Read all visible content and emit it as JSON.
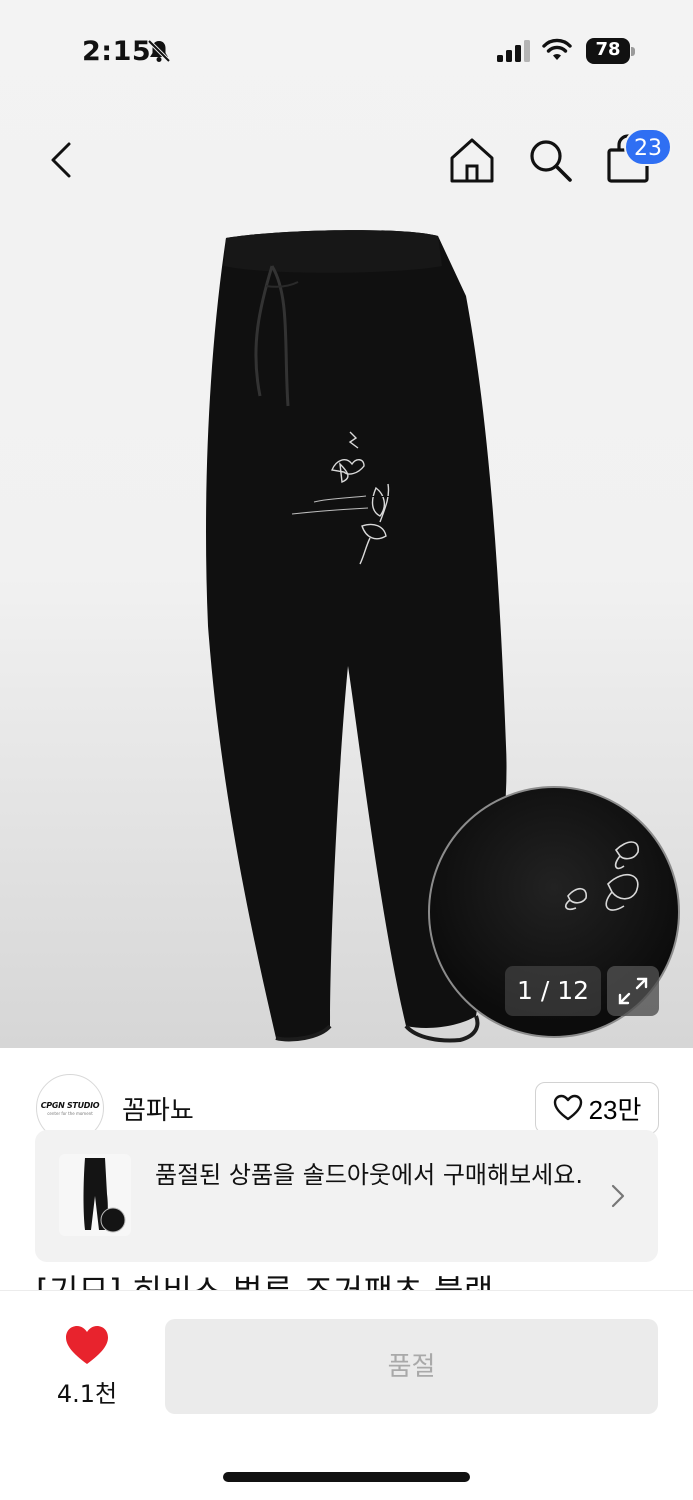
{
  "status_bar": {
    "time": "2:15",
    "battery_level": "78",
    "icons": [
      "bell-slash-icon",
      "cellular-signal-icon",
      "wifi-icon",
      "battery-icon"
    ]
  },
  "nav": {
    "icons": [
      "back-chevron-icon",
      "home-icon",
      "search-icon",
      "shopping-bag-icon"
    ],
    "cart_count": "23"
  },
  "gallery": {
    "counter": "1 / 12",
    "current_index": 1,
    "total": 12
  },
  "brand": {
    "logo_text": "CPGN STUDIO",
    "logo_subtext": "center for the moment",
    "name": "꼼파뇨",
    "like_count": "23만"
  },
  "soldout_banner": {
    "text": "품절된 상품을 솔드아웃에서 구매해보세요."
  },
  "product": {
    "title": "[기모] 히비스 벌룬 조거팬츠 블랙"
  },
  "bottom_bar": {
    "favorite_count": "4.1천",
    "purchase_button_label": "품절"
  },
  "colors": {
    "accent_badge": "#2f6ff3",
    "heart_red": "#e8232d",
    "disabled_button_bg": "#ebebeb",
    "disabled_button_text": "#a9a9a9"
  }
}
